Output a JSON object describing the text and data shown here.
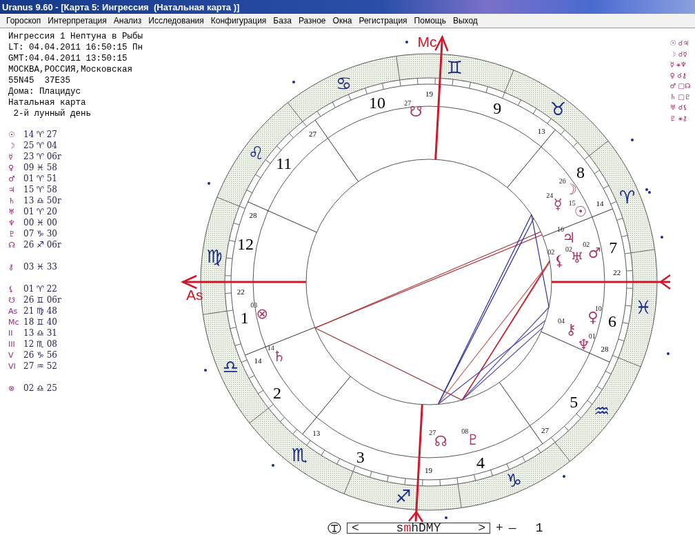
{
  "window": {
    "title": "Uranus 9.60 - [Карта 5: Ингрессия  (Натальная карта )]"
  },
  "menu": [
    "Гороскоп",
    "Интерпретация",
    "Анализ",
    "Исследования",
    "Конфигурация",
    "База",
    "Разное",
    "Окна",
    "Регистрация",
    "Помощь",
    "Выход"
  ],
  "info": [
    "Ингрессия 1 Нептуна в Рыбы",
    "LT: 04.04.2011 16:50:15 Пн",
    "GMT:04.04.2011 13:50:15",
    "МОСКВА,РОССИЯ,Московская",
    "55N45  37E35",
    "Дома: Плацидус",
    "Натальная карта",
    " 2-й лунный день"
  ],
  "positions": [
    [
      {
        "glyph": "☉",
        "value": "14 ♈ 27"
      },
      {
        "glyph": "☽",
        "value": "25 ♈ 04"
      },
      {
        "glyph": "☿",
        "value": "23 ♈ 06r"
      },
      {
        "glyph": "♀",
        "value": "09 ♓ 58"
      },
      {
        "glyph": "♂",
        "value": "01 ♈ 51"
      },
      {
        "glyph": "♃",
        "value": "15 ♈ 58"
      },
      {
        "glyph": "♄",
        "value": "13 ♎ 50r"
      },
      {
        "glyph": "♅",
        "value": "01 ♈ 20"
      },
      {
        "glyph": "♆",
        "value": "00 ♓ 00"
      },
      {
        "glyph": "♇",
        "value": "07 ♑ 30"
      },
      {
        "glyph": "☊",
        "value": "26 ♐ 06r"
      }
    ],
    [
      {
        "glyph": "⚷",
        "value": "03 ♓ 33"
      }
    ],
    [
      {
        "glyph": "⚸",
        "value": "01 ♈ 22"
      },
      {
        "glyph": "☋",
        "value": "26 ♊ 06r"
      },
      {
        "glyph": "As",
        "value": "21 ♍ 48"
      },
      {
        "glyph": "Mc",
        "value": "18 ♊ 40"
      },
      {
        "glyph": "II",
        "value": "13 ♎ 31"
      },
      {
        "glyph": "III",
        "value": "12 ♏ 08"
      },
      {
        "glyph": "V",
        "value": "26 ♑ 56"
      },
      {
        "glyph": "VI",
        "value": "27 ♒ 52"
      }
    ],
    [
      {
        "glyph": "⊗",
        "value": "02 ♎ 25"
      }
    ]
  ],
  "aspects": [
    "☉ ☌♃",
    "☽ ☌☿",
    "☿ ⚹♆",
    "♀ ☌⚷",
    "♂ □☊",
    "♄ □♇",
    "♅ ☌⚸",
    "♇ ⚹⚷"
  ],
  "chart": {
    "mc_label": "Mc",
    "asc_label": "As",
    "signs": [
      "♈",
      "♉",
      "♊",
      "♋",
      "♌",
      "♍",
      "♎",
      "♏",
      "♐",
      "♑",
      "♒",
      "♓"
    ],
    "houses": [
      {
        "number": "1",
        "cusp": "22"
      },
      {
        "number": "2",
        "cusp": "14"
      },
      {
        "number": "3",
        "cusp": "13"
      },
      {
        "number": "4",
        "cusp": "19"
      },
      {
        "number": "5",
        "cusp": "27"
      },
      {
        "number": "6",
        "cusp": "28"
      },
      {
        "number": "7",
        "cusp": "22"
      },
      {
        "number": "8",
        "cusp": "14"
      },
      {
        "number": "9",
        "cusp": "13"
      },
      {
        "number": "10",
        "cusp": "19"
      },
      {
        "number": "11",
        "cusp": "27"
      },
      {
        "number": "12",
        "cusp": "28"
      }
    ],
    "bodies": [
      {
        "glyph": "☋",
        "degree": "27"
      },
      {
        "glyph": "☽",
        "degree": "26"
      },
      {
        "glyph": "☿",
        "degree": "24"
      },
      {
        "glyph": "♃",
        "degree": "16"
      },
      {
        "glyph": "☉",
        "degree": "15"
      },
      {
        "glyph": "⚸",
        "degree": "02"
      },
      {
        "glyph": "♅",
        "degree": "02"
      },
      {
        "glyph": "♂",
        "degree": "02"
      },
      {
        "glyph": "♀",
        "degree": "10"
      },
      {
        "glyph": "⚷",
        "degree": "04"
      },
      {
        "glyph": "♆",
        "degree": "01"
      },
      {
        "glyph": "♇",
        "degree": "08"
      },
      {
        "glyph": "☊",
        "degree": "27"
      },
      {
        "glyph": "♄",
        "degree": "14"
      },
      {
        "glyph": "⊗",
        "degree": "03"
      }
    ]
  },
  "time_control": {
    "prev": "<",
    "units": [
      {
        "label": "s",
        "selected": false
      },
      {
        "label": "m",
        "selected": true
      },
      {
        "label": "h",
        "selected": false
      },
      {
        "label": "D",
        "selected": false
      },
      {
        "label": "M",
        "selected": false
      },
      {
        "label": "Y",
        "selected": false
      }
    ],
    "next": ">",
    "plus": "+",
    "minus": "—",
    "step": "1"
  }
}
